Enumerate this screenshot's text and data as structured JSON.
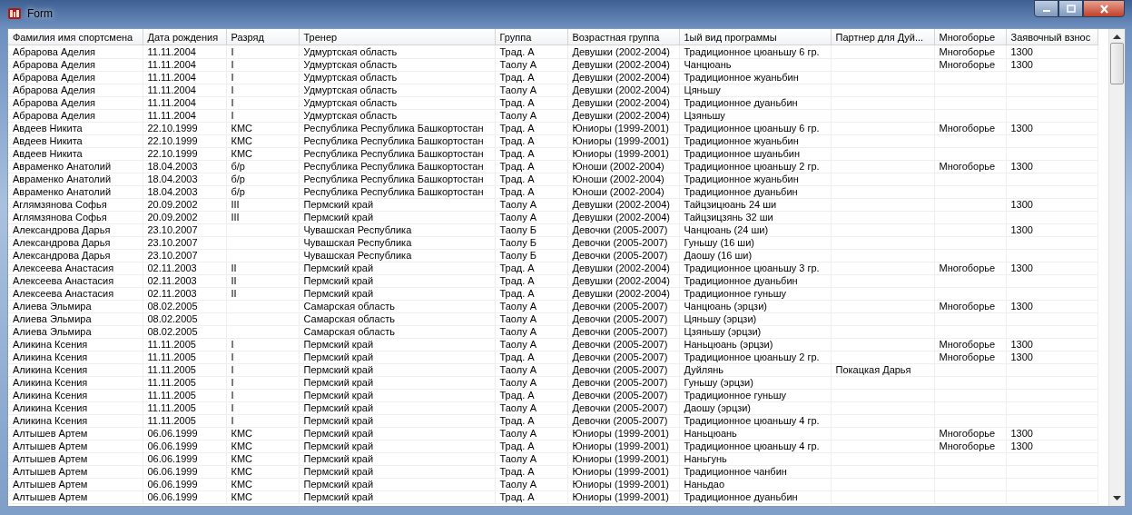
{
  "window": {
    "title": "Form"
  },
  "table": {
    "columns": [
      "Фамилия имя спортсмена",
      "Дата рождения",
      "Разряд",
      "Тренер",
      "Группа",
      "Возрастная группа",
      "1ый вид программы",
      "Партнер для Дуй...",
      "Многоборье",
      "Заявочный взнос"
    ],
    "rows": [
      [
        "Абрарова Аделия",
        "11.11.2004",
        "I",
        "Удмуртская область",
        "Трад. А",
        "Девушки (2002-2004)",
        "Традиционное цюаньшу 6 гр.",
        null,
        "Многоборье",
        "1300"
      ],
      [
        "Абрарова Аделия",
        "11.11.2004",
        "I",
        "Удмуртская область",
        "Таолу А",
        "Девушки (2002-2004)",
        "Чанцюань",
        null,
        "Многоборье",
        "1300"
      ],
      [
        "Абрарова Аделия",
        "11.11.2004",
        "I",
        "Удмуртская область",
        "Трад. А",
        "Девушки (2002-2004)",
        "Традиционное жуаньбин",
        null,
        null,
        null
      ],
      [
        "Абрарова Аделия",
        "11.11.2004",
        "I",
        "Удмуртская область",
        "Таолу А",
        "Девушки (2002-2004)",
        "Цяньшу",
        null,
        null,
        null
      ],
      [
        "Абрарова Аделия",
        "11.11.2004",
        "I",
        "Удмуртская область",
        "Трад. А",
        "Девушки (2002-2004)",
        "Традиционное дуаньбин",
        null,
        null,
        null
      ],
      [
        "Абрарова Аделия",
        "11.11.2004",
        "I",
        "Удмуртская область",
        "Таолу А",
        "Девушки (2002-2004)",
        "Цзяньшу",
        null,
        null,
        null
      ],
      [
        "Авдеев Никита",
        "22.10.1999",
        "КМС",
        "Республика Республика Башкортостан",
        "Трад. А",
        "Юниоры (1999-2001)",
        "Традиционное цюаньшу 6 гр.",
        null,
        "Многоборье",
        "1300"
      ],
      [
        "Авдеев Никита",
        "22.10.1999",
        "КМС",
        "Республика Республика Башкортостан",
        "Трад. А",
        "Юниоры (1999-2001)",
        "Традиционное жуаньбин",
        null,
        null,
        null
      ],
      [
        "Авдеев Никита",
        "22.10.1999",
        "КМС",
        "Республика Республика Башкортостан",
        "Трад. А",
        "Юниоры (1999-2001)",
        "Традиционное шуаньбин",
        null,
        null,
        null
      ],
      [
        "Авраменко Анатолий",
        "18.04.2003",
        "б/р",
        "Республика Республика Башкортостан",
        "Трад. А",
        "Юноши (2002-2004)",
        "Традиционное цюаньшу 2 гр.",
        null,
        "Многоборье",
        "1300"
      ],
      [
        "Авраменко Анатолий",
        "18.04.2003",
        "б/р",
        "Республика Республика Башкортостан",
        "Трад. А",
        "Юноши (2002-2004)",
        "Традиционное жуаньбин",
        null,
        null,
        null
      ],
      [
        "Авраменко Анатолий",
        "18.04.2003",
        "б/р",
        "Республика Республика Башкортостан",
        "Трад. А",
        "Юноши (2002-2004)",
        "Традиционное дуаньбин",
        null,
        null,
        null
      ],
      [
        "Аглямзянова Софья",
        "20.09.2002",
        "III",
        "Пермский край",
        "Таолу А",
        "Девушки (2002-2004)",
        "Тайцзицюань 24 ши",
        null,
        null,
        "1300"
      ],
      [
        "Аглямзянова Софья",
        "20.09.2002",
        "III",
        "Пермский край",
        "Таолу А",
        "Девушки (2002-2004)",
        "Тайцзицзянь 32 ши",
        null,
        null,
        null
      ],
      [
        "Александрова Дарья",
        "23.10.2007",
        null,
        "Чувашская Республика",
        "Таолу Б",
        "Девочки (2005-2007)",
        "Чанцюань (24 ши)",
        null,
        null,
        "1300"
      ],
      [
        "Александрова Дарья",
        "23.10.2007",
        null,
        "Чувашская Республика",
        "Таолу Б",
        "Девочки (2005-2007)",
        "Гуньшу (16 ши)",
        null,
        null,
        null
      ],
      [
        "Александрова Дарья",
        "23.10.2007",
        null,
        "Чувашская Республика",
        "Таолу Б",
        "Девочки (2005-2007)",
        "Даошу (16 ши)",
        null,
        null,
        null
      ],
      [
        "Алексеева Анастасия",
        "02.11.2003",
        "II",
        "Пермский край",
        "Трад. А",
        "Девушки (2002-2004)",
        "Традиционное цюаньшу 3 гр.",
        null,
        "Многоборье",
        "1300"
      ],
      [
        "Алексеева Анастасия",
        "02.11.2003",
        "II",
        "Пермский край",
        "Трад. А",
        "Девушки (2002-2004)",
        "Традиционное дуаньбин",
        null,
        null,
        null
      ],
      [
        "Алексеева Анастасия",
        "02.11.2003",
        "II",
        "Пермский край",
        "Трад. А",
        "Девушки (2002-2004)",
        "Традиционное гуньшу",
        null,
        null,
        null
      ],
      [
        "Алиева Эльмира",
        "08.02.2005",
        null,
        "Самарская область",
        "Таолу А",
        "Девочки (2005-2007)",
        "Чанцюань (эрцзи)",
        null,
        "Многоборье",
        "1300"
      ],
      [
        "Алиева Эльмира",
        "08.02.2005",
        null,
        "Самарская область",
        "Таолу А",
        "Девочки (2005-2007)",
        "Цяньшу (эрцзи)",
        null,
        null,
        null
      ],
      [
        "Алиева Эльмира",
        "08.02.2005",
        null,
        "Самарская область",
        "Таолу А",
        "Девочки (2005-2007)",
        "Цзяньшу (эрцзи)",
        null,
        null,
        null
      ],
      [
        "Аликина Ксения",
        "11.11.2005",
        "I",
        "Пермский край",
        "Таолу А",
        "Девочки (2005-2007)",
        "Наньцюань (эрцзи)",
        null,
        "Многоборье",
        "1300"
      ],
      [
        "Аликина Ксения",
        "11.11.2005",
        "I",
        "Пермский край",
        "Трад. А",
        "Девочки (2005-2007)",
        "Традиционное цюаньшу 2 гр.",
        null,
        "Многоборье",
        "1300"
      ],
      [
        "Аликина Ксения",
        "11.11.2005",
        "I",
        "Пермский край",
        "Таолу А",
        "Девочки (2005-2007)",
        "Дуйлянь",
        "Покацкая Дарья",
        null,
        null
      ],
      [
        "Аликина Ксения",
        "11.11.2005",
        "I",
        "Пермский край",
        "Таолу А",
        "Девочки (2005-2007)",
        "Гуньшу (эрцзи)",
        null,
        null,
        null
      ],
      [
        "Аликина Ксения",
        "11.11.2005",
        "I",
        "Пермский край",
        "Трад. А",
        "Девочки (2005-2007)",
        "Традиционное гуньшу",
        null,
        null,
        null
      ],
      [
        "Аликина Ксения",
        "11.11.2005",
        "I",
        "Пермский край",
        "Таолу А",
        "Девочки (2005-2007)",
        "Даошу (эрцзи)",
        null,
        null,
        null
      ],
      [
        "Аликина Ксения",
        "11.11.2005",
        "I",
        "Пермский край",
        "Трад. А",
        "Девочки (2005-2007)",
        "Традиционное цюаньшу 4 гр.",
        null,
        null,
        null
      ],
      [
        "Алтышев Артем",
        "06.06.1999",
        "КМС",
        "Пермский край",
        "Таолу А",
        "Юниоры (1999-2001)",
        "Наньцюань",
        null,
        "Многоборье",
        "1300"
      ],
      [
        "Алтышев Артем",
        "06.06.1999",
        "КМС",
        "Пермский край",
        "Трад. А",
        "Юниоры (1999-2001)",
        "Традиционное цюаньшу 4 гр.",
        null,
        "Многоборье",
        "1300"
      ],
      [
        "Алтышев Артем",
        "06.06.1999",
        "КМС",
        "Пермский край",
        "Таолу А",
        "Юниоры (1999-2001)",
        "Наньгунь",
        null,
        null,
        null
      ],
      [
        "Алтышев Артем",
        "06.06.1999",
        "КМС",
        "Пермский край",
        "Трад. А",
        "Юниоры (1999-2001)",
        "Традиционное чанбин",
        null,
        null,
        null
      ],
      [
        "Алтышев Артем",
        "06.06.1999",
        "КМС",
        "Пермский край",
        "Таолу А",
        "Юниоры (1999-2001)",
        "Наньдао",
        null,
        null,
        null
      ],
      [
        "Алтышев Артем",
        "06.06.1999",
        "КМС",
        "Пермский край",
        "Трад. А",
        "Юниоры (1999-2001)",
        "Традиционное дуаньбин",
        null,
        null,
        null
      ]
    ]
  }
}
